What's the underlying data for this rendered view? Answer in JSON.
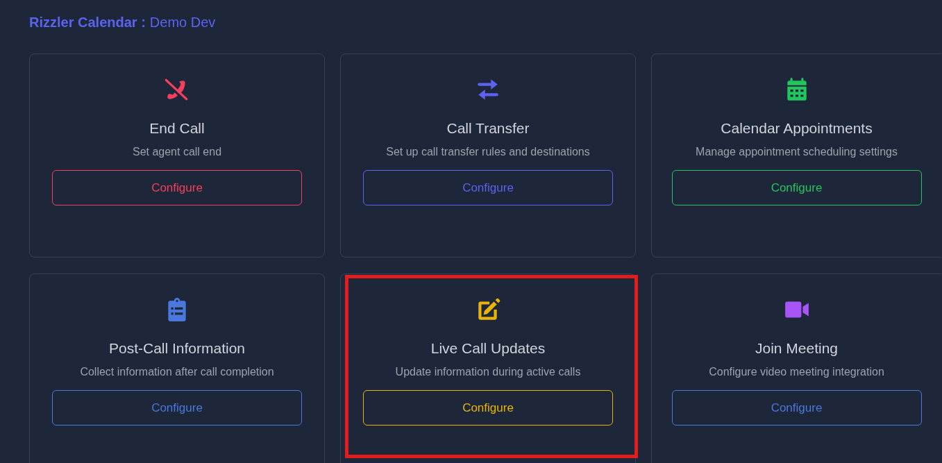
{
  "header": {
    "app": "Rizzler Calendar :",
    "name": "Demo Dev"
  },
  "cards": [
    {
      "kind": "phone-off",
      "title": "End Call",
      "description": "Set agent call end",
      "color": "#f43f5e",
      "highlighted": false,
      "button": {
        "label": "Configure",
        "color": "#f43f5e"
      }
    },
    {
      "kind": "transfer",
      "title": "Call Transfer",
      "description": "Set up call transfer rules and destinations",
      "color": "#5b63f0",
      "highlighted": false,
      "button": {
        "label": "Configure",
        "color": "#5b63f0"
      }
    },
    {
      "kind": "calendar",
      "title": "Calendar Appointments",
      "description": "Manage appointment scheduling settings",
      "color": "#22c55e",
      "highlighted": false,
      "button": {
        "label": "Configure",
        "color": "#22c55e"
      }
    },
    {
      "kind": "clipboard",
      "title": "Post-Call Information",
      "description": "Collect information after call completion",
      "color": "#4a78dc",
      "highlighted": false,
      "button": {
        "label": "Configure",
        "color": "#4a78dc"
      }
    },
    {
      "kind": "edit",
      "title": "Live Call Updates",
      "description": "Update information during active calls",
      "color": "#eab308",
      "highlighted": true,
      "button": {
        "label": "Configure",
        "color": "#eab308"
      }
    },
    {
      "kind": "video",
      "title": "Join Meeting",
      "description": "Configure video meeting integration",
      "color": "#a855f7",
      "highlighted": false,
      "button": {
        "label": "Configure",
        "color": "#4a78dc"
      }
    }
  ]
}
